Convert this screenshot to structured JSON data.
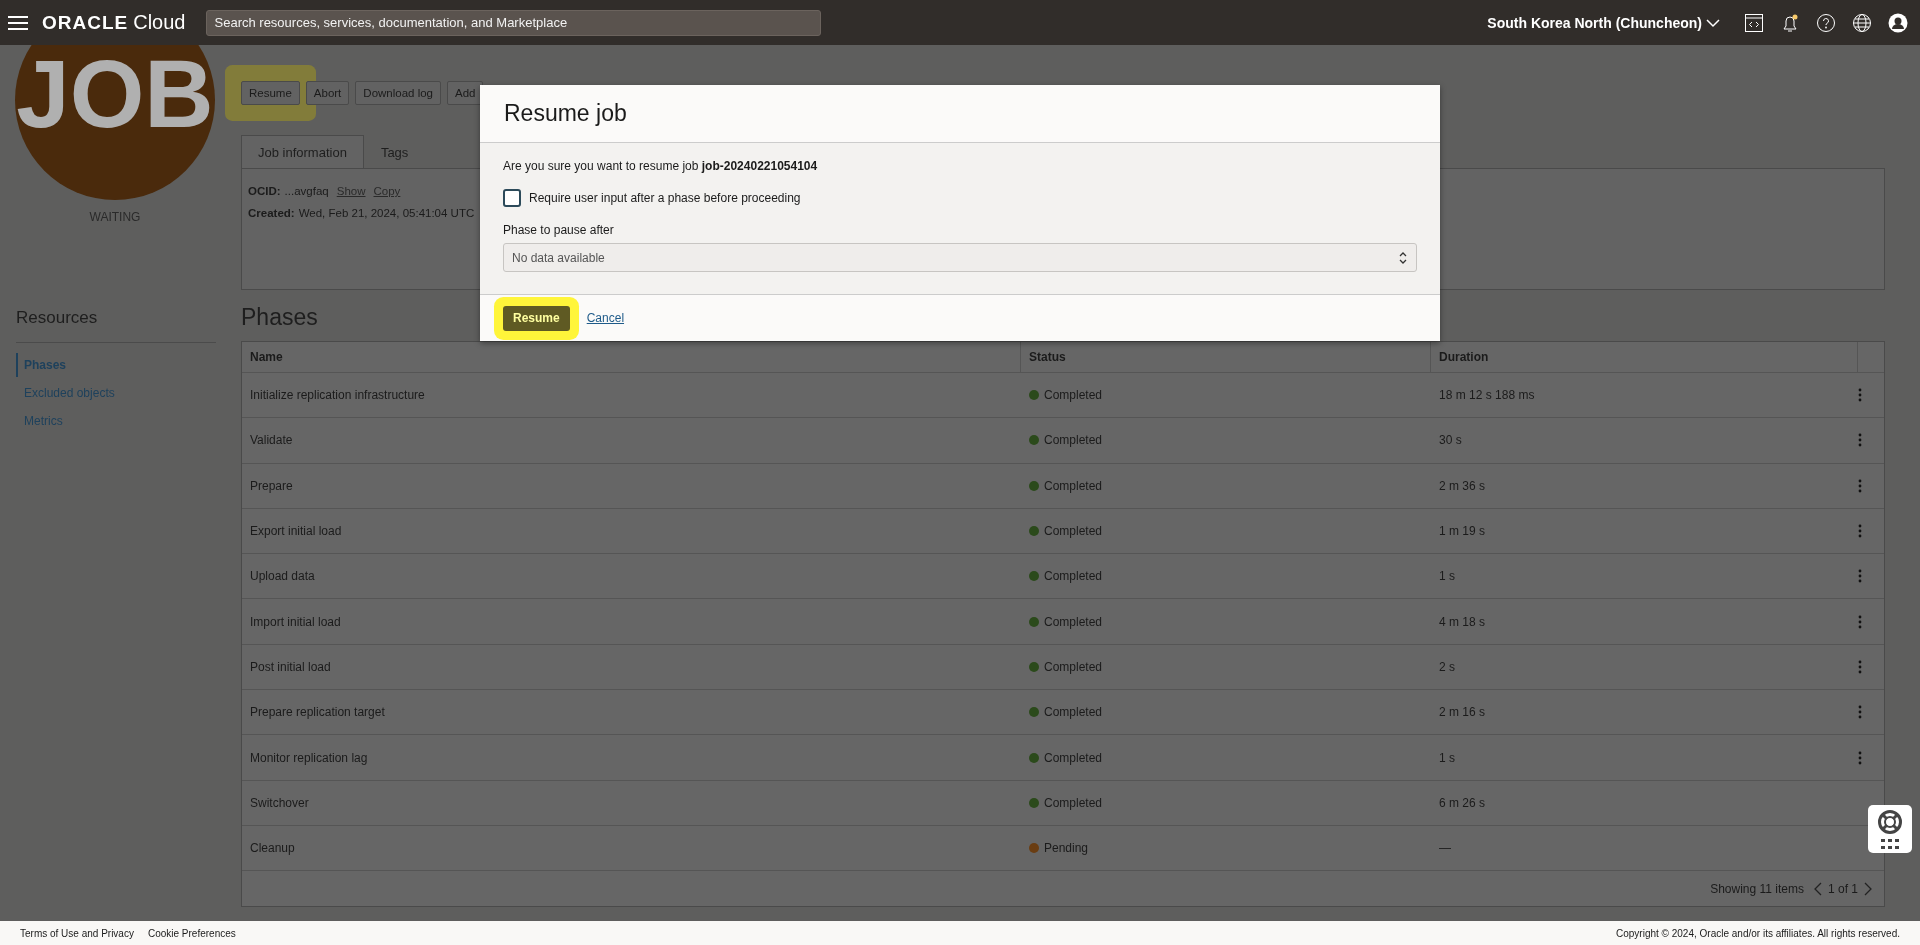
{
  "header": {
    "logo": {
      "brand": "ORACLE",
      "product": "Cloud"
    },
    "search": {
      "placeholder": "Search resources, services, documentation, and Marketplace"
    },
    "region": "South Korea North (Chuncheon)"
  },
  "job": {
    "badge": "JOB",
    "status": "WAITING"
  },
  "actions": [
    {
      "label": "Resume",
      "highlighted": true
    },
    {
      "label": "Abort",
      "highlighted": false
    },
    {
      "label": "Download log",
      "highlighted": false
    },
    {
      "label": "Add",
      "highlighted": false
    }
  ],
  "tabs": [
    {
      "label": "Job information",
      "selected": true
    },
    {
      "label": "Tags",
      "selected": false
    }
  ],
  "info": {
    "ocid_label": "OCID:",
    "ocid": "...avgfaq",
    "show": "Show",
    "copy": "Copy",
    "created_label": "Created:",
    "created": "Wed, Feb 21, 2024, 05:41:04 UTC"
  },
  "resources": {
    "title": "Resources",
    "items": [
      {
        "label": "Phases",
        "selected": true
      },
      {
        "label": "Excluded objects",
        "selected": false
      },
      {
        "label": "Metrics",
        "selected": false
      }
    ]
  },
  "phases": {
    "title": "Phases",
    "columns": [
      "Name",
      "Status",
      "Duration"
    ],
    "rows": [
      {
        "name": "Initialize replication infrastructure",
        "status": "Completed",
        "color": "#2b4a1b",
        "duration": "18 m 12 s 188 ms",
        "actions_menu": true
      },
      {
        "name": "Validate",
        "status": "Completed",
        "color": "#2b4a1b",
        "duration": "30 s",
        "actions_menu": true
      },
      {
        "name": "Prepare",
        "status": "Completed",
        "color": "#2b4a1b",
        "duration": "2 m 36 s",
        "actions_menu": true
      },
      {
        "name": "Export initial load",
        "status": "Completed",
        "color": "#2b4a1b",
        "duration": "1 m 19 s",
        "actions_menu": true
      },
      {
        "name": "Upload data",
        "status": "Completed",
        "color": "#2b4a1b",
        "duration": "1 s",
        "actions_menu": true
      },
      {
        "name": "Import initial load",
        "status": "Completed",
        "color": "#2b4a1b",
        "duration": "4 m 18 s",
        "actions_menu": true
      },
      {
        "name": "Post initial load",
        "status": "Completed",
        "color": "#2b4a1b",
        "duration": "2 s",
        "actions_menu": true
      },
      {
        "name": "Prepare replication target",
        "status": "Completed",
        "color": "#2b4a1b",
        "duration": "2 m 16 s",
        "actions_menu": true
      },
      {
        "name": "Monitor replication lag",
        "status": "Completed",
        "color": "#2b4a1b",
        "duration": "1 s",
        "actions_menu": true
      },
      {
        "name": "Switchover",
        "status": "Completed",
        "color": "#2b4a1b",
        "duration": "6 m 26 s",
        "actions_menu": false
      },
      {
        "name": "Cleanup",
        "status": "Pending",
        "color": "#6a3d12",
        "duration": "—",
        "actions_menu": false
      }
    ],
    "count": "Showing 11 items",
    "page": "1 of 1"
  },
  "dialog": {
    "title": "Resume job",
    "message": "Are you sure you want to resume job **job-20240221054104**",
    "checkbox": {
      "label": "Require user input after a phase before proceeding",
      "checked": false
    },
    "select": {
      "label": "Phase to pause after",
      "value": "No data available"
    },
    "confirm": {
      "label": "Resume",
      "highlighted": true
    },
    "cancel": "Cancel"
  },
  "footer": {
    "links": [
      "Terms of Use and Privacy",
      "Cookie Preferences"
    ],
    "copyright": "Copyright © 2024, Oracle and/or its affiliates. All rights reserved."
  }
}
